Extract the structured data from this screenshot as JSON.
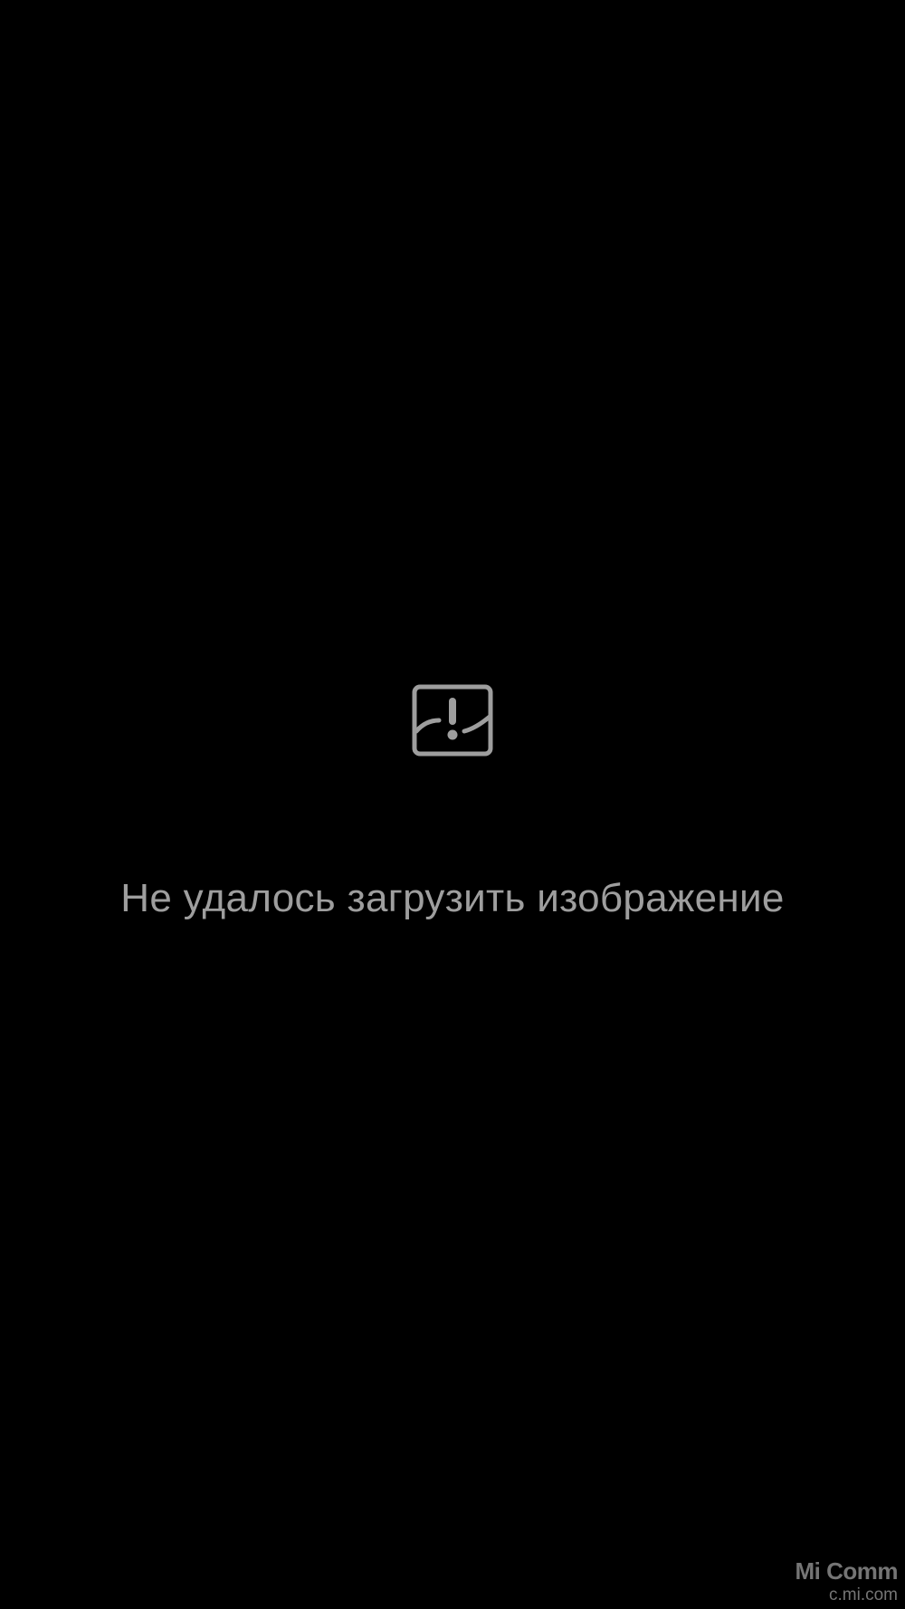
{
  "background_color": "#000000",
  "error": {
    "icon": "broken-image-icon",
    "message": "Не удалось загрузить изображение",
    "text_color": "#9e9e9e"
  },
  "watermark": {
    "brand": "Mi Comm",
    "site": "c.mi.com"
  }
}
